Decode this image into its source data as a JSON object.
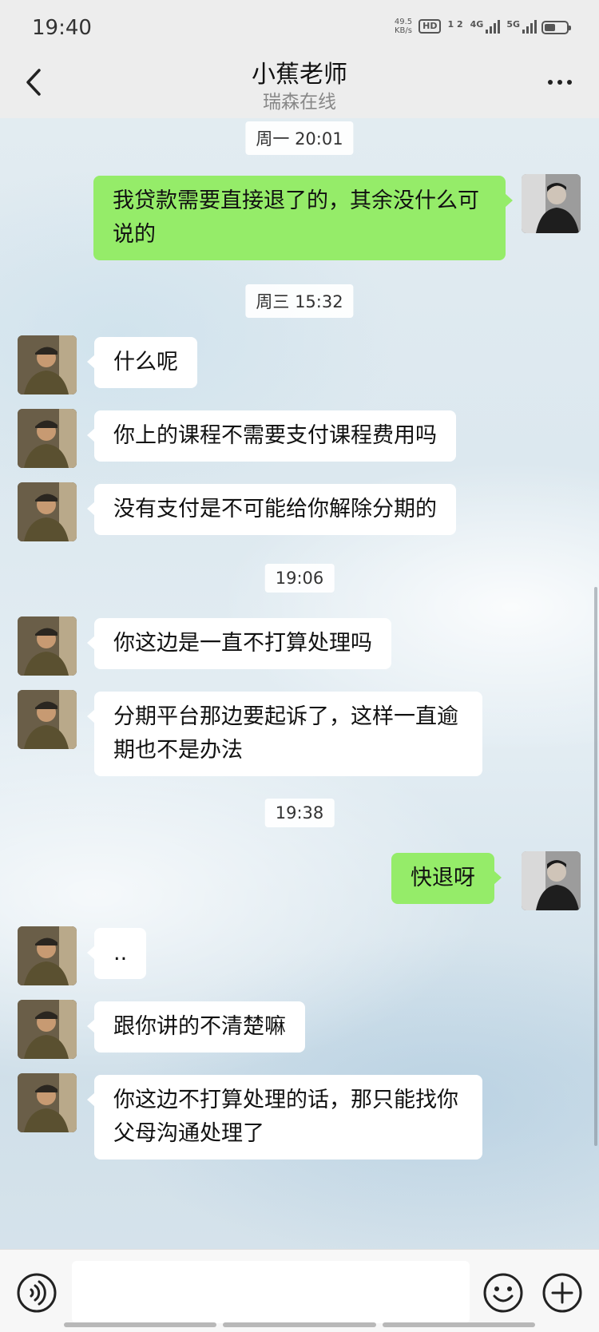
{
  "status_bar": {
    "time": "19:40",
    "net_speed_value": "49.5",
    "net_speed_unit": "KB/s",
    "hd_label": "HD",
    "sim_label": "1 2",
    "signal_1": "4G",
    "signal_2": "5G"
  },
  "header": {
    "title": "小蕉老师",
    "subtitle": "瑞森在线"
  },
  "messages": [
    {
      "type": "timestamp",
      "text": "周一 20:01"
    },
    {
      "type": "self",
      "text": "我贷款需要直接退了的，其余没什么可说的"
    },
    {
      "type": "timestamp",
      "text": "周三 15:32"
    },
    {
      "type": "other",
      "text": "什么呢"
    },
    {
      "type": "other",
      "text": "你上的课程不需要支付课程费用吗"
    },
    {
      "type": "other",
      "text": "没有支付是不可能给你解除分期的"
    },
    {
      "type": "timestamp",
      "text": "19:06"
    },
    {
      "type": "other",
      "text": "你这边是一直不打算处理吗"
    },
    {
      "type": "other",
      "text": "分期平台那边要起诉了，这样一直逾期也不是办法"
    },
    {
      "type": "timestamp",
      "text": "19:38"
    },
    {
      "type": "self",
      "text": "快退呀"
    },
    {
      "type": "other",
      "text": ".."
    },
    {
      "type": "other",
      "text": "跟你讲的不清楚嘛"
    },
    {
      "type": "other",
      "text": "你这边不打算处理的话，那只能找你父母沟通处理了"
    }
  ],
  "input_bar": {
    "placeholder": "",
    "voice_icon": "voice-icon",
    "emoji_icon": "emoji-icon",
    "plus_icon": "plus-icon"
  },
  "colors": {
    "self_bubble": "#95ec69",
    "other_bubble": "#ffffff",
    "bar_bg": "#ededed"
  }
}
